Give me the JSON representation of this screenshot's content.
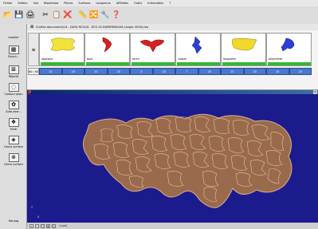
{
  "menu": [
    "Fichier",
    "Edition",
    "Vue",
    "Bisolemoa",
    "Pièces",
    "Surfaces",
    "Longueurs",
    "Affiliates",
    "Outils",
    "Information",
    "?"
  ],
  "toolbar": [
    "📂",
    "💾",
    "🖨",
    "✂",
    "📋",
    "❌",
    "📏",
    "🔀",
    "🔧",
    "❓"
  ],
  "sidebar": {
    "header": "Leather",
    "items": [
      {
        "label": "Douch..."
      },
      {
        "label": "Réjecté"
      },
      {
        "label": "Contour peau"
      },
      {
        "label": "Auto-exer..."
      },
      {
        "label": "Multi"
      },
      {
        "label": "Calcul surface"
      },
      {
        "label": "Calcul surface"
      }
    ],
    "footer": "Harnag"
  },
  "document": {
    "title": "D:\\Mes documents\\14 - DATA RCS\\16 - RCS 10.0\\BISREM\\GAS (Angle 2000).lsw"
  },
  "pieces": [
    {
      "name": "applique",
      "color": "#f2e23a"
    },
    {
      "name": "bout",
      "color": "#d81f1f"
    },
    {
      "name": "tenth",
      "color": "#d81f1f"
    },
    {
      "name": "claque",
      "color": "#2b3fd6"
    },
    {
      "name": "languette",
      "color": "#f2d82a"
    },
    {
      "name": "talonnette",
      "color": "#2b3fd6"
    }
  ],
  "counts": {
    "label": "60 ( 60",
    "values": [
      "15",
      "20",
      "10",
      "20",
      "3",
      "20",
      "7",
      "20",
      "13",
      "20",
      "15",
      "20"
    ]
  },
  "view": {
    "title": "1",
    "axis_y": "Y",
    "axis_x": "X"
  },
  "status": {
    "text": "1 (ori)"
  },
  "colors": {
    "canvas_bg": "#1c1b8e",
    "hide_fill": "#9a6a4c",
    "count_bar": "#4a78cc",
    "quota_bar": "#33b833"
  }
}
